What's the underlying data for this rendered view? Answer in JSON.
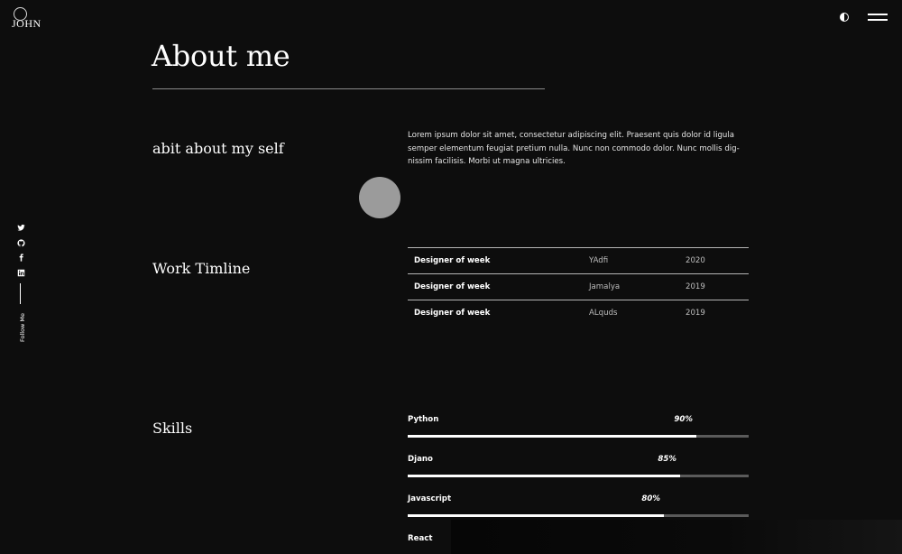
{
  "header": {
    "logo_text": "JOHN",
    "theme_icon": "half-circle-icon",
    "menu_icon": "hamburger-icon"
  },
  "social": {
    "items": [
      {
        "name": "twitter",
        "icon": "twitter-icon"
      },
      {
        "name": "github",
        "icon": "github-icon"
      },
      {
        "name": "facebook",
        "icon": "facebook-icon"
      },
      {
        "name": "linkedin",
        "icon": "linkedin-icon"
      }
    ],
    "follow_label": "Follow Me"
  },
  "main": {
    "title": "About me",
    "about": {
      "heading": "abit about my self",
      "text": "Lorem ipsum dolor sit amet, consectetur adipiscing elit. Praesent quis dolor id ligula semper elementum feugiat pretium nulla. Nunc non commodo dolor. Nunc mollis dig- nissim facilisis. Morbi ut magna ultricies."
    },
    "work": {
      "heading": "Work Timline",
      "rows": [
        {
          "title": "Designer of week",
          "company": "YAdfi",
          "year": "2020"
        },
        {
          "title": "Designer of week",
          "company": "Jamalya",
          "year": "2019"
        },
        {
          "title": "Designer of week",
          "company": "ALquds",
          "year": "2019"
        }
      ]
    },
    "skills": {
      "heading": "Skills",
      "items": [
        {
          "name": "Python",
          "percent_label": "90%",
          "value": 90
        },
        {
          "name": "Djano",
          "percent_label": "85%",
          "value": 85
        },
        {
          "name": "Javascript",
          "percent_label": "80%",
          "value": 80
        },
        {
          "name": "React",
          "percent_label": "",
          "value": null
        }
      ]
    }
  },
  "colors": {
    "background": "#0d0d0d",
    "text": "#ffffff",
    "muted": "#bdbdbd",
    "track": "#5a5a5a",
    "cursor": "#9b9b9b"
  }
}
